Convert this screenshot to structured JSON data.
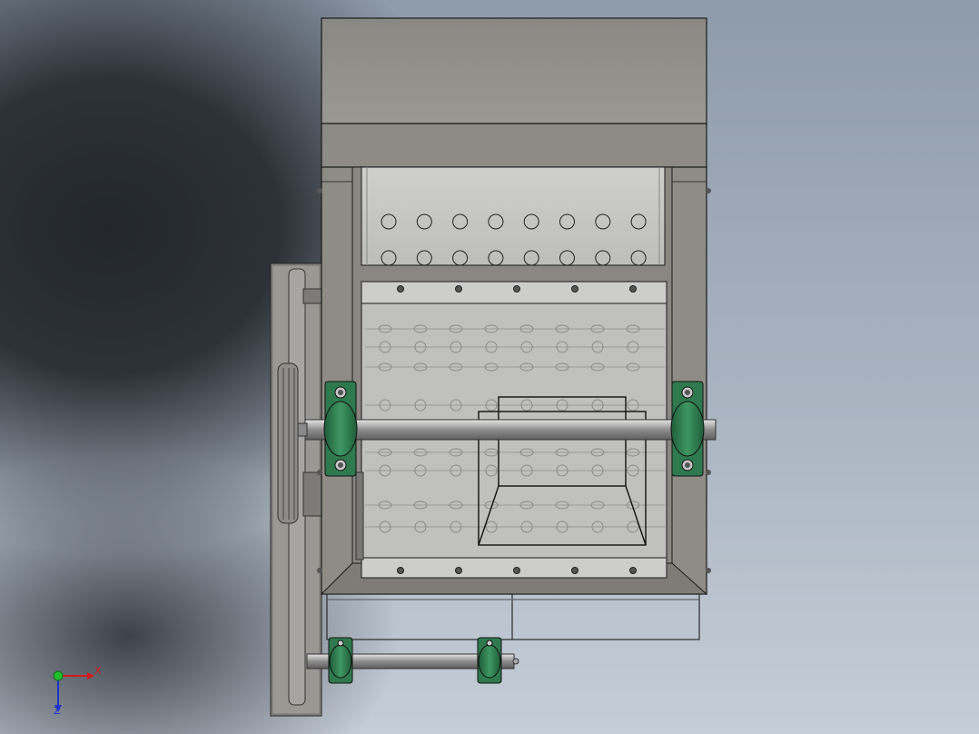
{
  "viewport": {
    "background": "gradient-gray-blue",
    "model_view": "front-orthographic",
    "render_mode": "shaded-with-edges"
  },
  "triad": {
    "x_label": "X",
    "z_label": "Z",
    "x_color": "#d21c1c",
    "y_color": "#1fbf2c",
    "z_color": "#1c33c8"
  },
  "model": {
    "parts": [
      "hopper",
      "screen-plate",
      "rotor-housing",
      "rotor-shaft",
      "bearing-block-left",
      "bearing-block-right",
      "pulley",
      "belt-guard",
      "discharge-chute",
      "lower-shaft",
      "bearing-block-lower-left",
      "bearing-block-lower-right"
    ],
    "colors": {
      "housing": "#8f8c86",
      "plate": "#c3c3c1",
      "bearing": "#2e7a4e",
      "shaft": "#9b9b9b",
      "edge": "#1a1a1a"
    }
  }
}
